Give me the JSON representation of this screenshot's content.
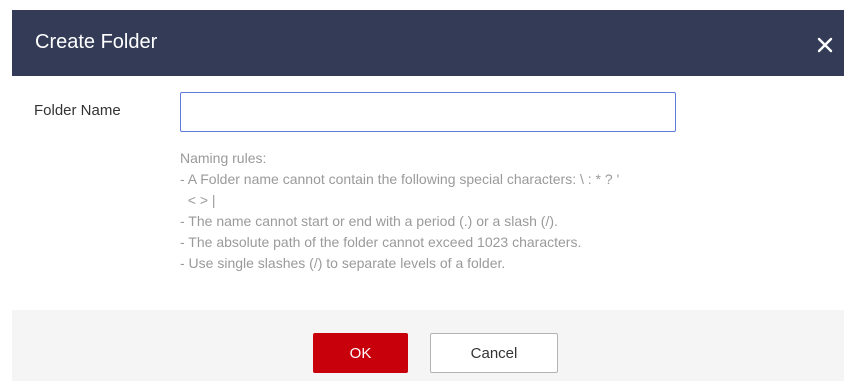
{
  "dialog": {
    "title": "Create Folder",
    "close_icon": "close-icon"
  },
  "form": {
    "folder_name_label": "Folder Name",
    "folder_name_value": "",
    "folder_name_placeholder": ""
  },
  "rules": {
    "heading": "Naming rules:",
    "lines": [
      "- A Folder name cannot contain the following special characters: \\ : * ? '",
      "  < > |",
      "- The name cannot start or end with a period (.) or a slash (/).",
      "- The absolute path of the folder cannot exceed 1023 characters.",
      "- Use single slashes (/) to separate levels of a folder."
    ]
  },
  "buttons": {
    "ok_label": "OK",
    "cancel_label": "Cancel"
  },
  "colors": {
    "header_bg": "#333b57",
    "primary_button": "#c7000b",
    "input_focus_border": "#5b7fd9"
  }
}
